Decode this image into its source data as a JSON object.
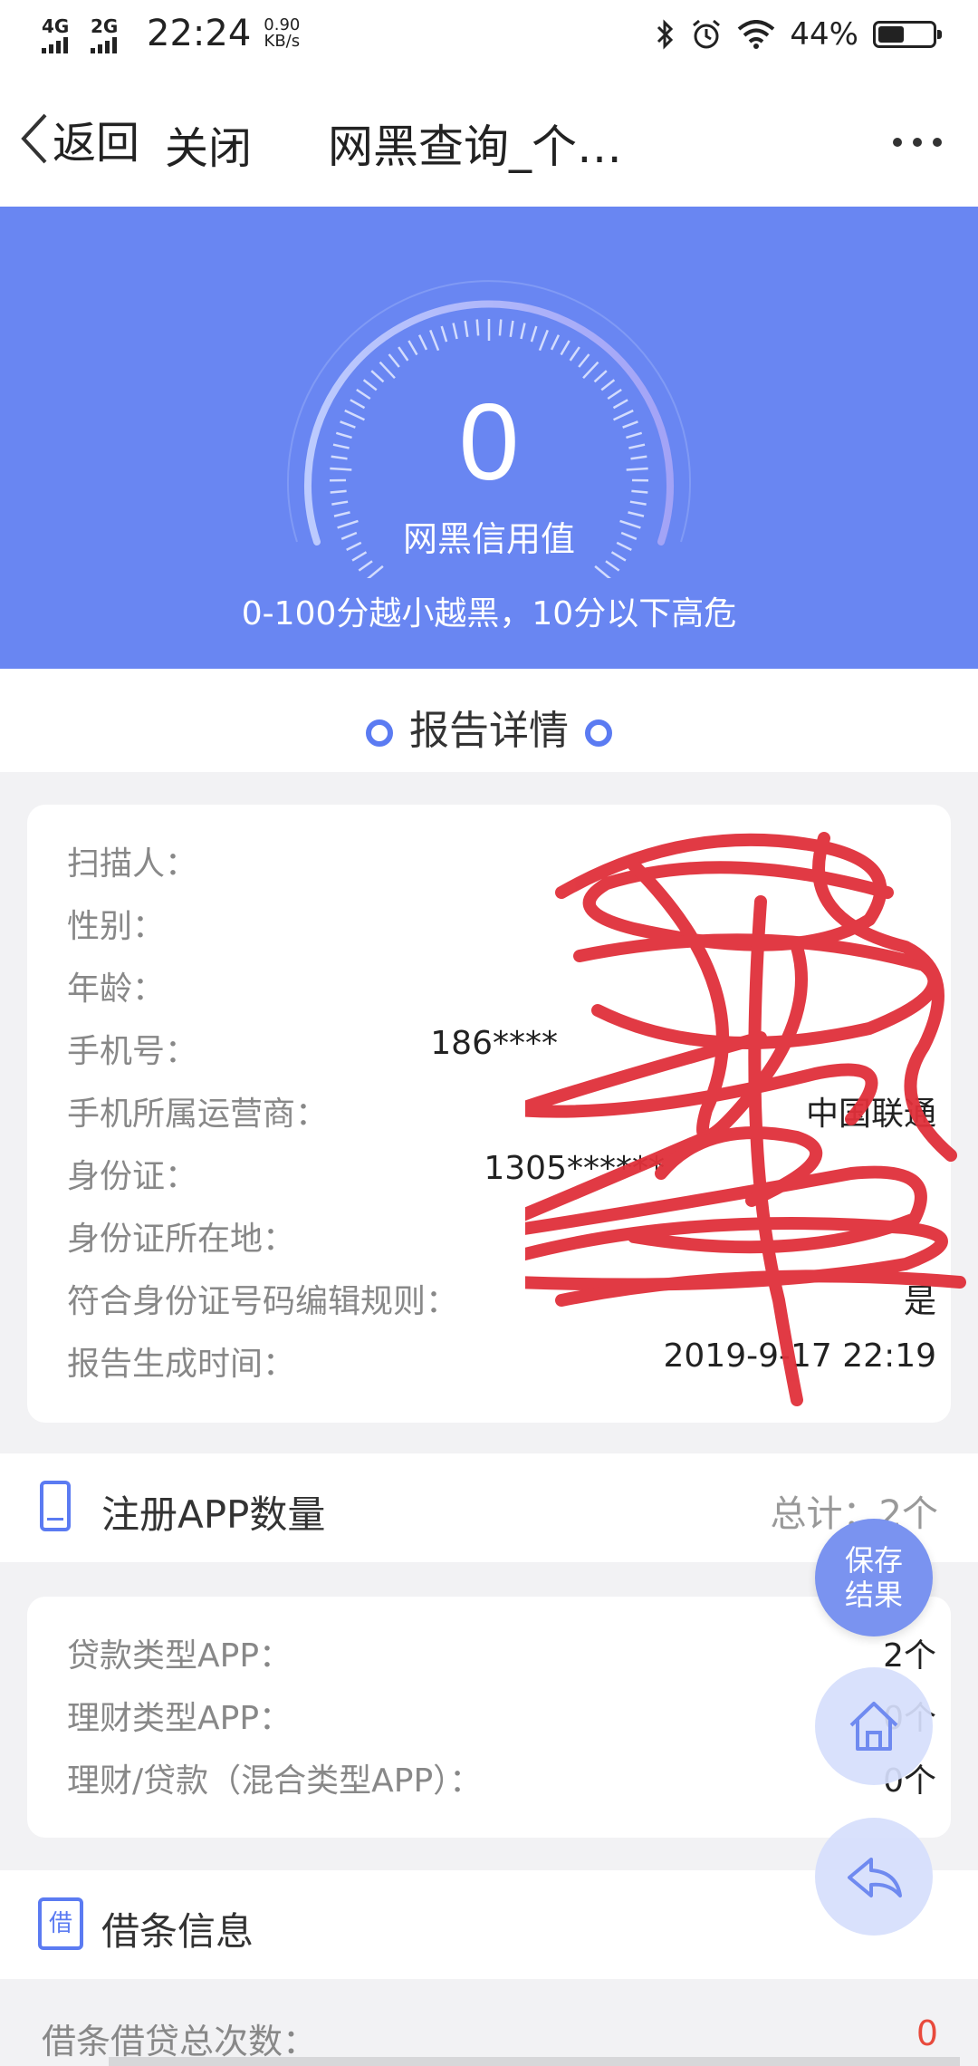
{
  "statusbar": {
    "network1": "4G",
    "network2": "2G",
    "time": "22:24",
    "speed_value": "0.90",
    "speed_unit": "KB/s",
    "battery_pct": "44%"
  },
  "navbar": {
    "back_label": "返回",
    "close_label": "关闭",
    "title": "网黑查询_个…"
  },
  "hero": {
    "score": "0",
    "score_label": "网黑信用值",
    "note": "0-100分越小越黑，10分以下高危",
    "bg_color": "#6986f2"
  },
  "report": {
    "section_title": "报告详情",
    "rows": [
      {
        "label": "扫描人：",
        "value": ""
      },
      {
        "label": "性别：",
        "value": ""
      },
      {
        "label": "年龄：",
        "value": ""
      },
      {
        "label": "手机号：",
        "value": "186****"
      },
      {
        "label": "手机所属运营商：",
        "value": "中国联通"
      },
      {
        "label": "身份证：",
        "value": "1305******"
      },
      {
        "label": "身份证所在地：",
        "value": ""
      },
      {
        "label": "符合身份证号码编辑规则：",
        "value": "是"
      },
      {
        "label": "报告生成时间：",
        "value": "2019-9-17 22:19"
      }
    ]
  },
  "apps": {
    "title": "注册APP数量",
    "total": "总计：2个",
    "rows": [
      {
        "label": "贷款类型APP：",
        "value": "2个"
      },
      {
        "label": "理财类型APP：",
        "value": "0个"
      },
      {
        "label": "理财/贷款（混合类型APP）：",
        "value": "0个"
      }
    ]
  },
  "loan": {
    "title": "借条信息",
    "icon_char": "借",
    "row_label": "借条借贷总次数：",
    "row_value": "0"
  },
  "fab": {
    "save_line1": "保存",
    "save_line2": "结果"
  },
  "accent_color": "#5b7bf2",
  "alert_color": "#e84a3c"
}
